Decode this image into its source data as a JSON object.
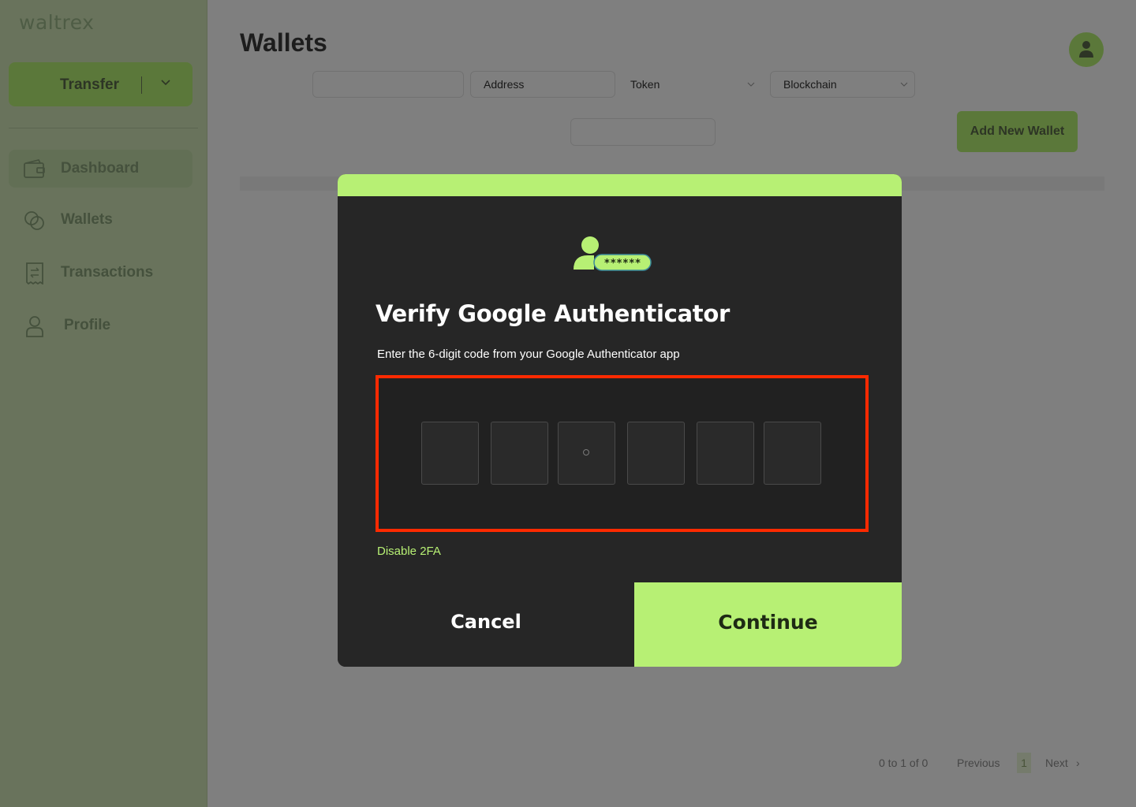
{
  "app": {
    "brand": "waltrex"
  },
  "sidebar": {
    "transfer_label": "Transfer",
    "items": [
      {
        "label": "Dashboard",
        "icon": "wallet-card-icon",
        "active": true
      },
      {
        "label": "Wallets",
        "icon": "coins-icon",
        "active": false
      },
      {
        "label": "Transactions",
        "icon": "receipt-icon",
        "active": false
      },
      {
        "label": "Profile",
        "icon": "user-icon",
        "active": false
      }
    ]
  },
  "main": {
    "title": "Wallets",
    "filters": {
      "address_placeholder": "Address",
      "token_label": "Token",
      "blockchain_label": "Blockchain"
    },
    "add_wallet_label": "Add New Wallet",
    "pagination": {
      "summary": "0 to 1 of 0",
      "previous": "Previous",
      "page": "1",
      "next": "Next"
    }
  },
  "modal": {
    "icon": "user-password-icon",
    "icon_mask": "******",
    "title": "Verify Google Authenticator",
    "subtitle": "Enter the 6-digit code from your Google Authenticator app",
    "code_digits": [
      "",
      "",
      "",
      "",
      "",
      ""
    ],
    "disable_link": "Disable 2FA",
    "cancel_label": "Cancel",
    "continue_label": "Continue"
  },
  "colors": {
    "accent": "#b7f074",
    "modal_bg": "#262626",
    "highlight": "#ff2a00",
    "sidebar_bg": "#d3e7b9"
  }
}
